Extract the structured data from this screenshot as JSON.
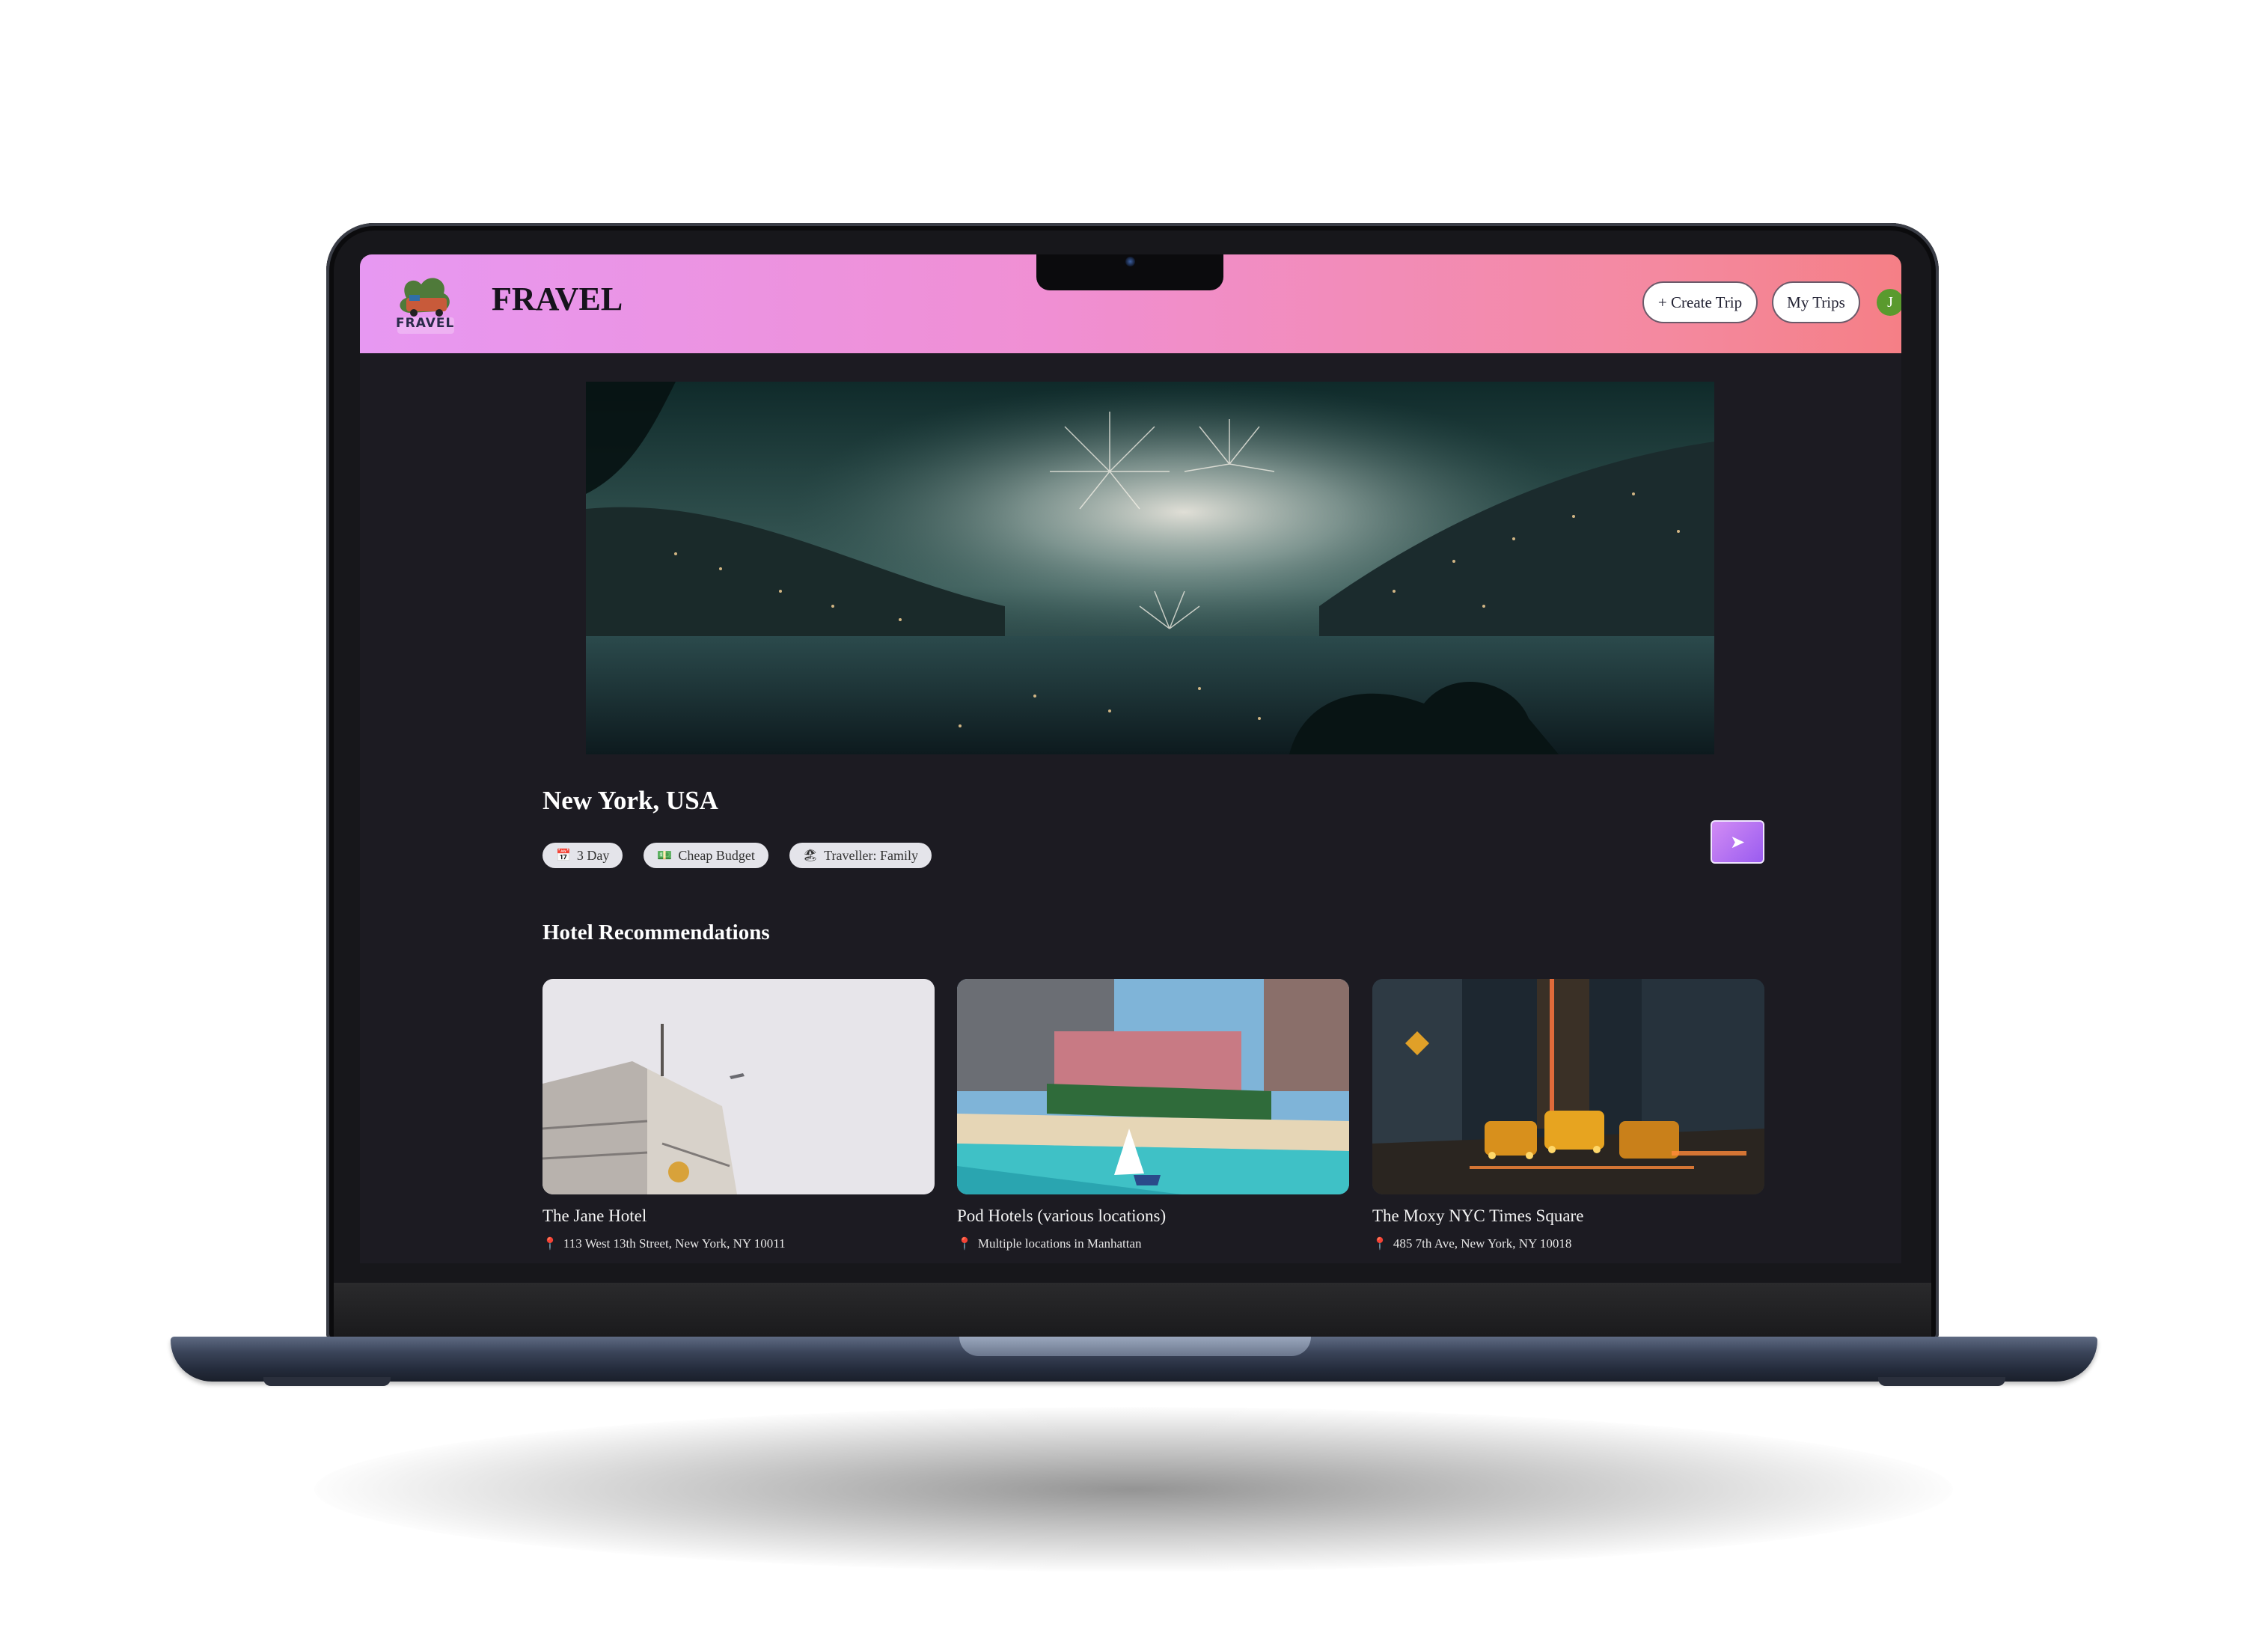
{
  "app": {
    "brand": "FRAVEL",
    "logo_text": "FRAVEL"
  },
  "header": {
    "create_trip": "+ Create Trip",
    "my_trips": "My Trips",
    "avatar_initial": "J"
  },
  "trip": {
    "location": "New York, USA",
    "chips": [
      {
        "icon": "calendar-icon",
        "glyph": "📅",
        "label": "3 Day"
      },
      {
        "icon": "money-icon",
        "glyph": "💵",
        "label": "Cheap Budget"
      },
      {
        "icon": "family-icon",
        "glyph": "🏖",
        "label": "Traveller: Family"
      }
    ],
    "share_glyph": "➤"
  },
  "hotels_section": {
    "title": "Hotel Recommendations",
    "hotels": [
      {
        "name": "The Jane Hotel",
        "address": "113 West 13th Street, New York, NY 10011"
      },
      {
        "name": "Pod Hotels (various locations)",
        "address": "Multiple locations in Manhattan"
      },
      {
        "name": "The Moxy NYC Times Square",
        "address": "485 7th Ave, New York, NY 10018"
      }
    ]
  },
  "colors": {
    "header_gradient_start": "#e798f2",
    "header_gradient_end": "#f57f86",
    "screen_bg": "#1c1b22",
    "pin": "#ff3d7a",
    "share_button": "#b878f3"
  }
}
